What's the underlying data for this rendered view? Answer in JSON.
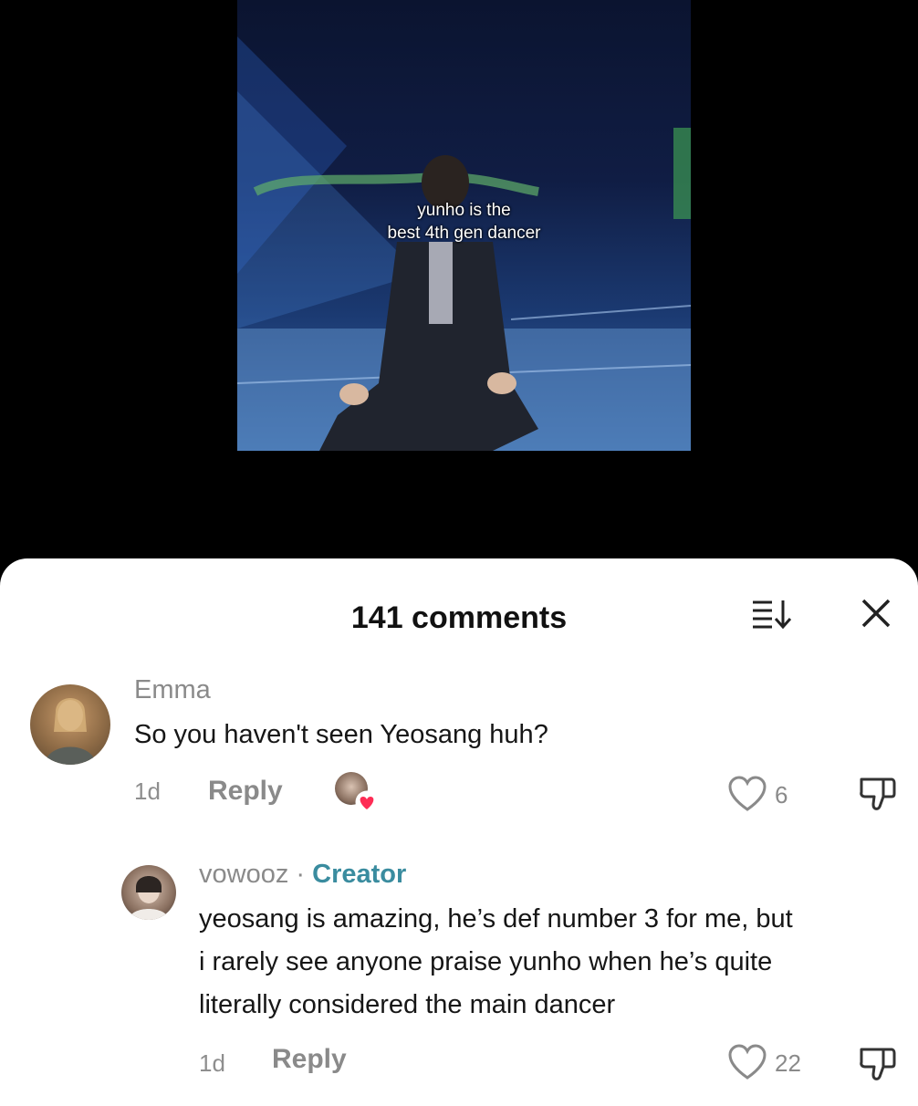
{
  "video": {
    "caption_line1": "yunho is the",
    "caption_line2": "best 4th gen dancer"
  },
  "comments_panel": {
    "title": "141 comments",
    "sort_icon": "sort-icon",
    "close_icon": "close-icon"
  },
  "comments": [
    {
      "username": "Emma",
      "text": "So you haven't seen Yeosang huh?",
      "age": "1d",
      "reply_label": "Reply",
      "likes": "6",
      "liked_by_creator": true
    },
    {
      "username": "vowooz",
      "separator": "·",
      "badge": "Creator",
      "text_line1": "yeosang is amazing, he’s def number 3 for me, but",
      "text_line2": "i rarely see anyone praise yunho when he’s quite",
      "text_line3": "literally considered the main dancer",
      "age": "1d",
      "reply_label": "Reply",
      "likes": "22"
    }
  ],
  "colors": {
    "creator_badge": "#3a8c9f",
    "heart_red": "#fe2c55"
  }
}
